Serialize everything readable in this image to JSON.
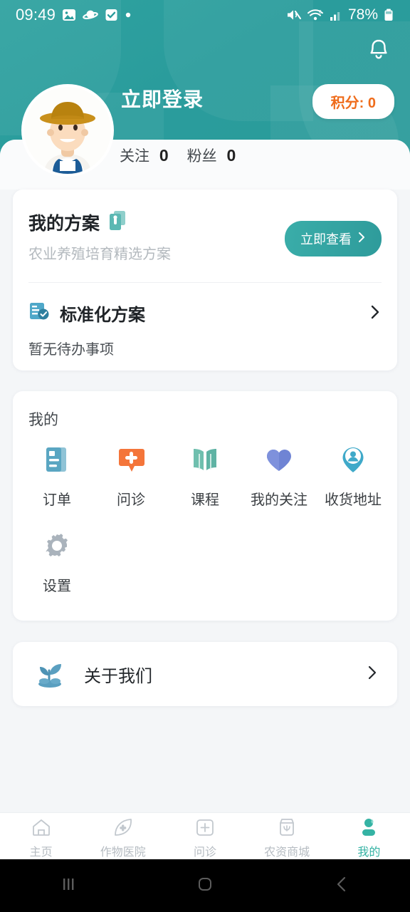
{
  "status_bar": {
    "time": "09:49",
    "battery_percent": "78%",
    "icons": [
      "image-icon",
      "saturn-icon",
      "checkbox-icon",
      "dot-icon",
      "mute-icon",
      "wifi-icon",
      "signal-icon",
      "battery-icon"
    ]
  },
  "header": {
    "login_label": "立即登录",
    "points_label": "积分: 0",
    "bell_icon": "notification-bell-icon",
    "avatar_icon": "farmer-avatar",
    "accent_color": "#2a9c9c",
    "points_color": "#ef6c1b"
  },
  "stats": {
    "following_label": "关注",
    "following_count": "0",
    "followers_label": "粉丝",
    "followers_count": "0"
  },
  "plan_card": {
    "title": "我的方案",
    "title_icon": "plan-document-icon",
    "subtitle": "农业养殖培育精选方案",
    "view_button": "立即查看",
    "std_row_label": "标准化方案",
    "std_row_icon": "standard-plan-icon",
    "empty_text": "暂无待办事项"
  },
  "mine_card": {
    "section_title": "我的",
    "items": [
      {
        "label": "订单",
        "icon": "order-icon",
        "color": "#6aacc4"
      },
      {
        "label": "问诊",
        "icon": "consult-icon",
        "color": "#f4753a"
      },
      {
        "label": "课程",
        "icon": "course-icon",
        "color": "#63b5a4"
      },
      {
        "label": "我的关注",
        "icon": "heart-icon",
        "color": "#6f84d4"
      },
      {
        "label": "收货地址",
        "icon": "location-icon",
        "color": "#3fa9c9"
      },
      {
        "label": "设置",
        "icon": "gear-icon",
        "color": "#b0b8c0"
      }
    ]
  },
  "about_card": {
    "label": "关于我们",
    "icon": "sprout-icon"
  },
  "bottom_nav": {
    "active_index": 4,
    "active_color": "#35b3a4",
    "items": [
      {
        "label": "主页",
        "icon": "home-icon"
      },
      {
        "label": "作物医院",
        "icon": "crop-hospital-icon"
      },
      {
        "label": "问诊",
        "icon": "consultation-plus-icon"
      },
      {
        "label": "农资商城",
        "icon": "agri-store-icon"
      },
      {
        "label": "我的",
        "icon": "profile-icon"
      }
    ]
  },
  "system_nav": {
    "recents_icon": "recents-icon",
    "home_icon": "home-square-icon",
    "back_icon": "back-chevron-icon"
  }
}
